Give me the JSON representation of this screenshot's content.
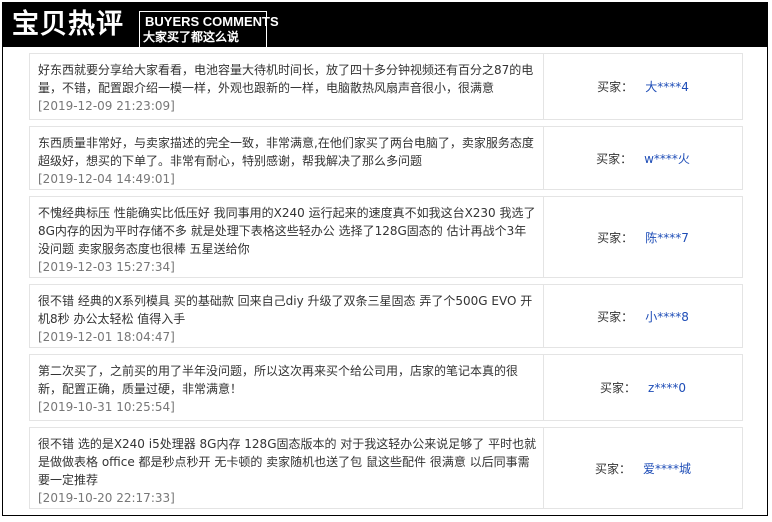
{
  "header": {
    "title": "宝贝热评",
    "subtitle_en": "BUYERS COMMENTS",
    "subtitle_cn": "大家买了都这么说"
  },
  "buyer_label": "买家：",
  "reviews": [
    {
      "text": "好东西就要分享给大家看看，电池容量大待机时间长，放了四十多分钟视频还有百分之87的电量，不错，配置跟介绍一模一样，外观也跟新的一样，电脑散热风扇声音很小，很满意",
      "date": "[2019-12-09 21:23:09]",
      "buyer": "大****4"
    },
    {
      "text": "东西质量非常好，与卖家描述的完全一致，非常满意,在他们家买了两台电脑了，卖家服务态度超级好，想买的下单了。非常有耐心，特别感谢，帮我解决了那么多问题",
      "date": "[2019-12-04 14:49:01]",
      "buyer": "w****火"
    },
    {
      "text": "不愧经典标压 性能确实比低压好 我同事用的X240 运行起来的速度真不如我这台X230 我选了8G内存的因为平时存储不多 就是处理下表格这些轻办公 选择了128G固态的 估计再战个3年没问题 卖家服务态度也很棒 五星送给你",
      "date": "[2019-12-03 15:27:34]",
      "buyer": "陈****7"
    },
    {
      "text": "很不错 经典的X系列模具 买的基础款 回来自己diy 升级了双条三星固态 弄了个500G EVO 开机8秒 办公太轻松 值得入手",
      "date": "[2019-12-01 18:04:47]",
      "buyer": "小****8"
    },
    {
      "text": "第二次买了，之前买的用了半年没问题，所以这次再来买个给公司用，店家的笔记本真的很新，配置正确，质量过硬，非常满意！",
      "date": "[2019-10-31 10:25:54]",
      "buyer": "z****0"
    },
    {
      "text": "很不错 选的是X240 i5处理器 8G内存 128G固态版本的 对于我这轻办公来说足够了 平时也就是做做表格 office 都是秒点秒开 无卡顿的 卖家随机也送了包 鼠这些配件 很满意 以后同事需要一定推荐",
      "date": "[2019-10-20 22:17:33]",
      "buyer": "爱****城"
    }
  ]
}
